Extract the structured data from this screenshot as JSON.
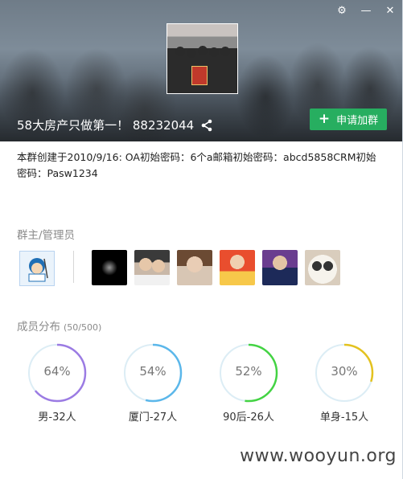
{
  "window_controls": [
    "⚙",
    "—",
    "✕"
  ],
  "group": {
    "title": "58大房产只做第一！ 88232044",
    "join_label": "申请加群",
    "description": "本群创建于2010/9/16:  OA初始密码：6个a邮箱初始密码：abcd5858CRM初始密码：Pasw1234"
  },
  "admins_section": {
    "label": "群主/管理员"
  },
  "members_section": {
    "label": "成员分布",
    "count": "(50/500)"
  },
  "stats": [
    {
      "percent_text": "64%",
      "value": 0.64,
      "caption": "男-32人",
      "color": "#9b7be3"
    },
    {
      "percent_text": "54%",
      "value": 0.54,
      "caption": "厦门-27人",
      "color": "#5bb7ea"
    },
    {
      "percent_text": "52%",
      "value": 0.52,
      "caption": "90后-26人",
      "color": "#43d343"
    },
    {
      "percent_text": "30%",
      "value": 0.3,
      "caption": "单身-15人",
      "color": "#e3c21f"
    }
  ],
  "watermark": "www.wooyun.org"
}
